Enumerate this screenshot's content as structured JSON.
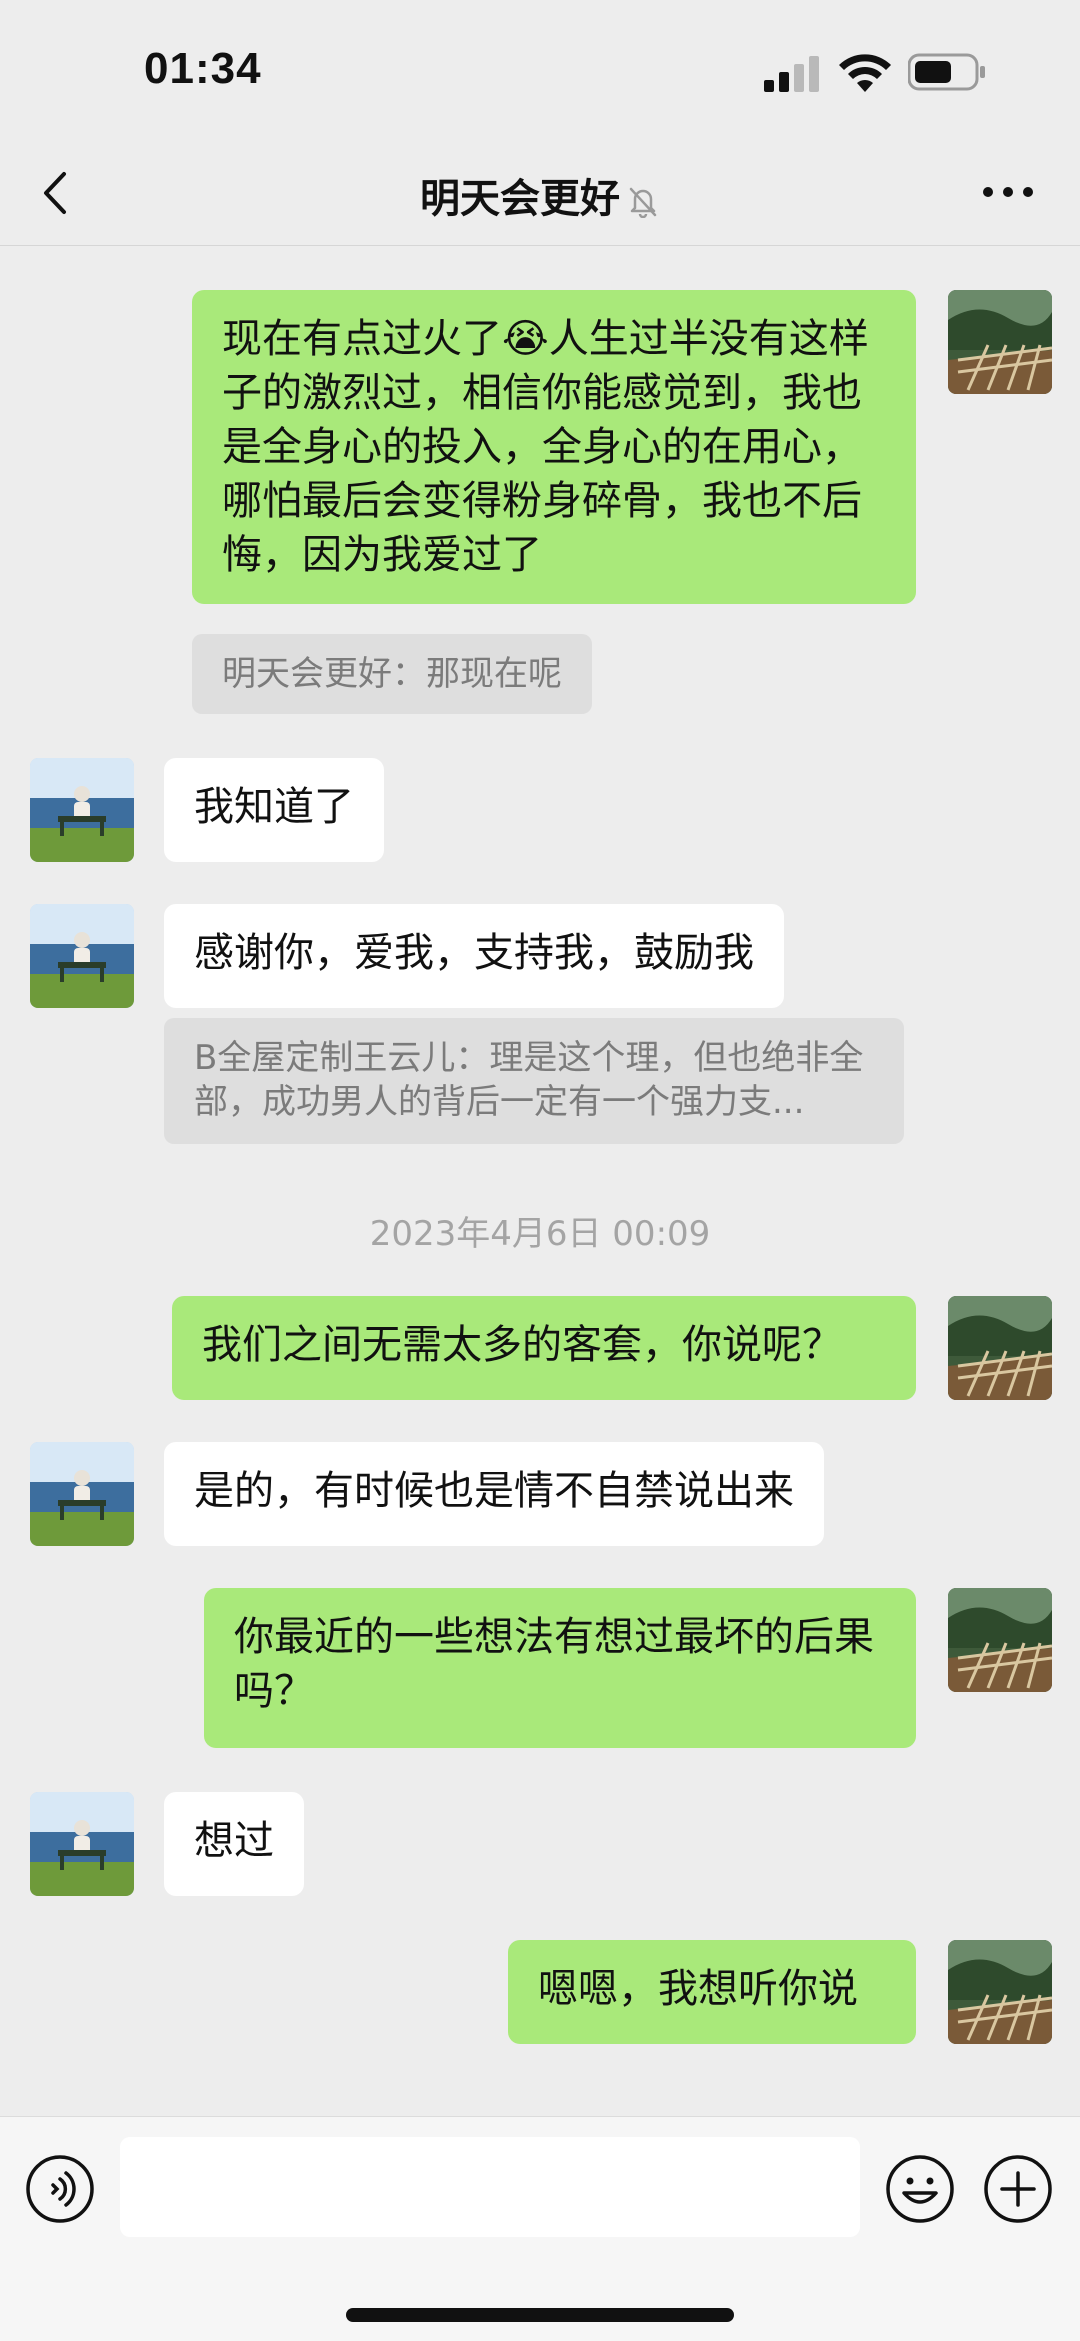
{
  "status_bar": {
    "time": "01:34",
    "icons": [
      "signal-icon",
      "wifi-icon",
      "battery-icon"
    ]
  },
  "nav": {
    "title": "明天会更好",
    "icons": [
      "back-icon",
      "mute-icon",
      "more-icon"
    ]
  },
  "messages": [
    {
      "side": "right",
      "text": "现在有点过火了😭人生过半没有这样子的激烈过，相信你能感觉到，我也是全身心的投入，全身心的在用心，哪怕最后会变得粉身碎骨，我也不后悔，因为我爱过了",
      "quote": "明天会更好：那现在呢"
    },
    {
      "side": "left",
      "text": "我知道了"
    },
    {
      "side": "left",
      "text": "感谢你，爱我，支持我，鼓励我",
      "quote": "B全屋定制王云儿：理是这个理，但也绝非全部，成功男人的背后一定有一个强力支..."
    },
    {
      "timestamp": "2023年4月6日 00:09"
    },
    {
      "side": "right",
      "text": "我们之间无需太多的客套，你说呢？"
    },
    {
      "side": "left",
      "text": "是的，有时候也是情不自禁说出来"
    },
    {
      "side": "right",
      "text": "你最近的一些想法有想过最坏的后果吗？"
    },
    {
      "side": "left",
      "text": "想过"
    },
    {
      "side": "right",
      "text": "嗯嗯，我想听你说"
    }
  ],
  "input_bar": {
    "value": "",
    "icons": [
      "voice-icon",
      "emoji-icon",
      "plus-icon"
    ]
  },
  "colors": {
    "background": "#ededed",
    "sent_bubble": "#a9e97a",
    "received_bubble": "#ffffff",
    "quote_bg": "#dedede"
  }
}
